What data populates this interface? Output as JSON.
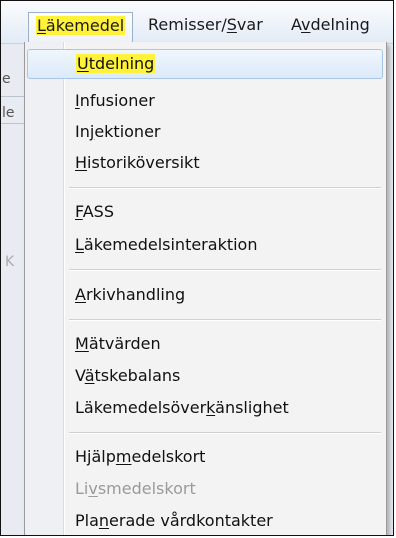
{
  "menubar": {
    "items": [
      {
        "pre": "",
        "mn": "L",
        "post": "äkemedel"
      },
      {
        "pre": "Remisser/",
        "mn": "S",
        "post": "var"
      },
      {
        "pre": "A",
        "mn": "v",
        "post": "delning"
      }
    ]
  },
  "dropdown": {
    "items": [
      {
        "pre": "",
        "mn": "U",
        "post": "tdelning"
      },
      {
        "pre": "",
        "mn": "I",
        "post": "nfusioner"
      },
      {
        "pre": "In",
        "mn": "j",
        "post": "ektioner"
      },
      {
        "pre": "",
        "mn": "H",
        "post": "istoriköversikt"
      },
      {
        "pre": "",
        "mn": "F",
        "post": "ASS"
      },
      {
        "pre": "",
        "mn": "L",
        "post": "äkemedelsinteraktion"
      },
      {
        "pre": "",
        "mn": "A",
        "post": "rkivhandling"
      },
      {
        "pre": "",
        "mn": "M",
        "post": "ätvärden"
      },
      {
        "pre": "V",
        "mn": "ä",
        "post": "tskebalans"
      },
      {
        "pre": "Läkemedelsöver",
        "mn": "k",
        "post": "änslighet"
      },
      {
        "pre": "Hjälp",
        "mn": "m",
        "post": "edelskort"
      },
      {
        "pre": "Li",
        "mn": "v",
        "post": "smedelskort"
      },
      {
        "pre": "Pla",
        "mn": "n",
        "post": "erade vårdkontakter"
      }
    ]
  },
  "background": {
    "left_chars": [
      "e",
      "le",
      "K"
    ],
    "right_chars": []
  },
  "colors": {
    "highlight": "#fff238",
    "hover_border": "#a8c6ea",
    "disabled_text": "#9a9a9a"
  }
}
